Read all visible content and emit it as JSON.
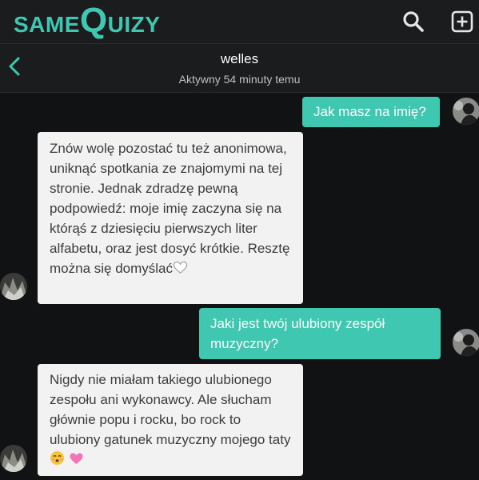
{
  "app": {
    "logo_same": "SAME",
    "logo_q": "Q",
    "logo_uizy": "UIZY",
    "accent": "#3fc7b1"
  },
  "header_icons": [
    "search-icon",
    "add-icon"
  ],
  "chat": {
    "contact_name": "welles",
    "status": "Aktywny 54 minuty temu"
  },
  "messages": [
    {
      "from": "me",
      "text": "Jak masz na imię?"
    },
    {
      "from": "them",
      "text": "Znów wolę pozostać tu też anonimowa, uniknąć spotkania ze znajomymi na tej stronie. Jednak zdradzę pewną podpowiedź: moje imię zaczyna się na którąś z dziesięciu pierwszych liter alfabetu, oraz jest dosyć krótkie. Resztę można się domyślać",
      "emoji": "white-heart-icon"
    },
    {
      "from": "me",
      "text": "Jaki jest twój ulubiony zespół muzyczny?"
    },
    {
      "from": "them",
      "text": "Nigdy nie miałam takiego ulubionego zespołu ani wykonawcy. Ale słucham głównie popu i rocku, bo rock to ulubiony gatunek muzyczny mojego taty",
      "emoji": [
        "kissing-face-icon",
        "pink-heart-icon"
      ]
    }
  ]
}
